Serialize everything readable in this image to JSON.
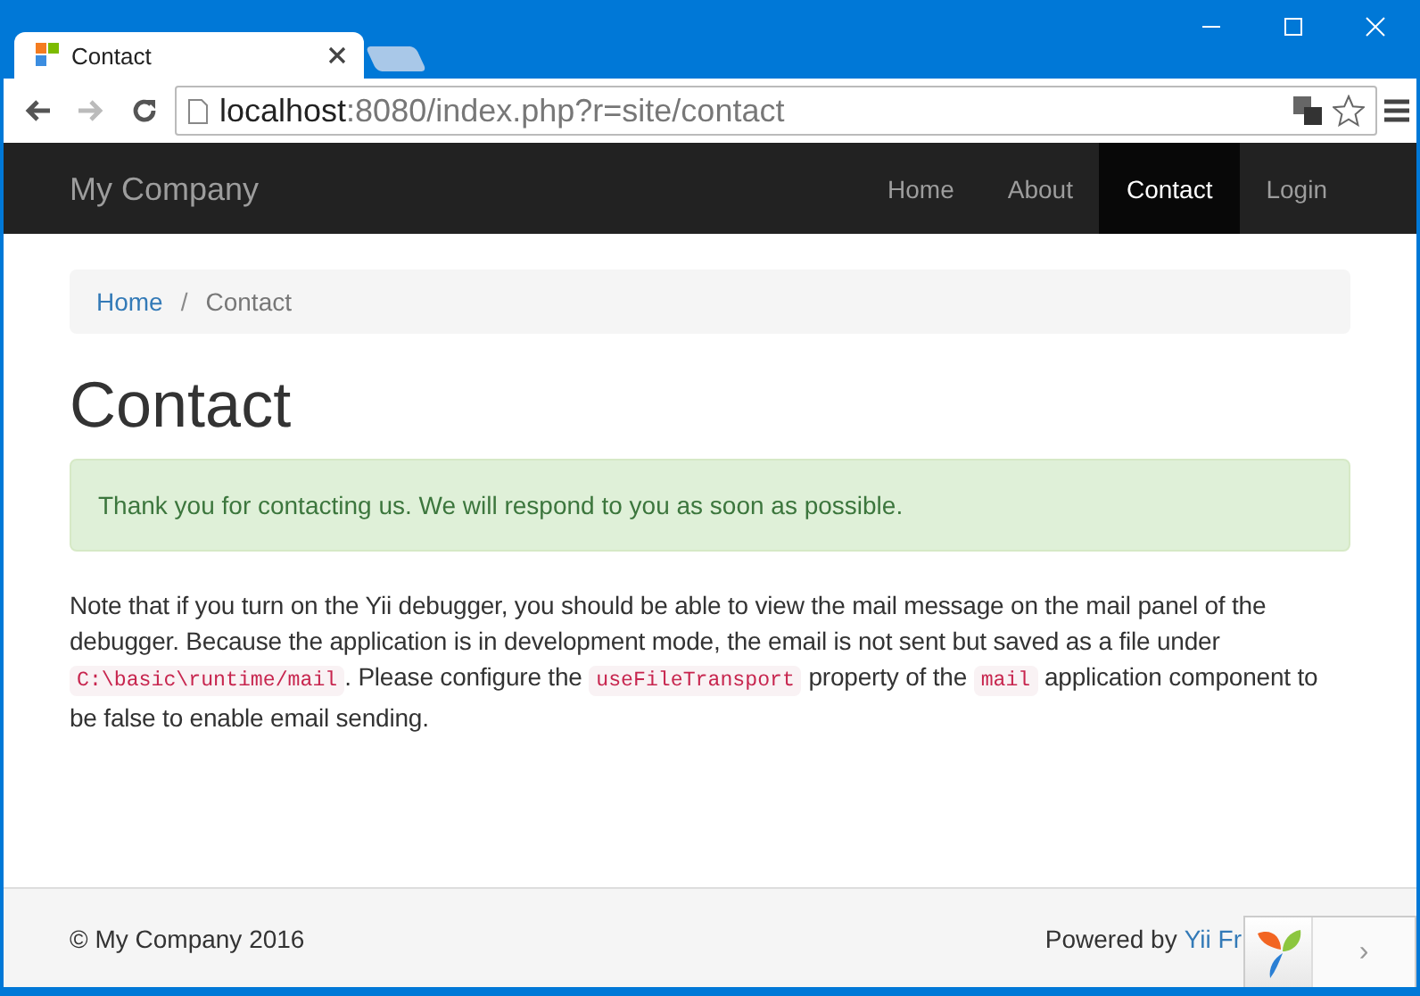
{
  "browser": {
    "tab": {
      "title": "Contact"
    },
    "forward": {
      "disabled": true
    },
    "address": {
      "host": "localhost",
      "rest": ":8080/index.php?r=site/contact"
    }
  },
  "navbar": {
    "brand": "My Company",
    "items": [
      {
        "label": "Home",
        "selected": false
      },
      {
        "label": "About",
        "selected": false
      },
      {
        "label": "Contact",
        "selected": true
      },
      {
        "label": "Login",
        "selected": false
      }
    ]
  },
  "breadcrumb": [
    {
      "label": "Home",
      "kind": "link"
    },
    {
      "label": "/",
      "kind": "separator"
    },
    {
      "label": "Contact",
      "kind": "current"
    }
  ],
  "heading": "Contact",
  "alert": "Thank you for contacting us. We will respond to you as soon as possible.",
  "note": [
    {
      "kind": "text",
      "text": "Note that if you turn on the Yii debugger, you should be able to view the mail message on the mail panel of the debugger. Because the application is in development mode, the email is not sent but saved as a file under "
    },
    {
      "kind": "code",
      "text": "C:\\basic\\runtime/mail"
    },
    {
      "kind": "text",
      "text": ". Please configure the "
    },
    {
      "kind": "code",
      "text": "useFileTransport"
    },
    {
      "kind": "text",
      "text": " property of the "
    },
    {
      "kind": "code",
      "text": "mail"
    },
    {
      "kind": "text",
      "text": " application component to be false to enable email sending."
    }
  ],
  "footer": {
    "copyright": "© My Company 2016",
    "powered_by": "Powered by",
    "link": "Yii Fr"
  },
  "debug_toolbar": {
    "toggle": "›"
  }
}
